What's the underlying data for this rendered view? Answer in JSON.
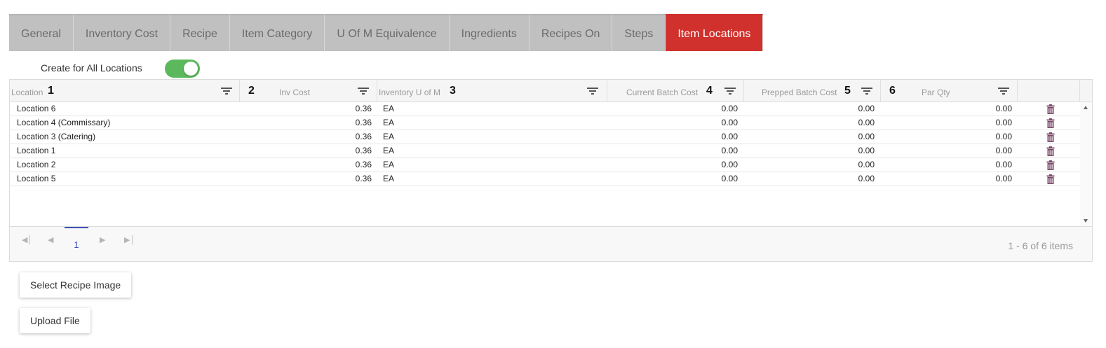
{
  "tabs": [
    {
      "label": "General"
    },
    {
      "label": "Inventory Cost"
    },
    {
      "label": "Recipe"
    },
    {
      "label": "Item Category"
    },
    {
      "label": "U Of M Equivalence"
    },
    {
      "label": "Ingredients"
    },
    {
      "label": "Recipes On"
    },
    {
      "label": "Steps"
    },
    {
      "label": "Item Locations",
      "active": true
    }
  ],
  "toggle": {
    "label": "Create for All Locations",
    "on": true
  },
  "grid": {
    "columns": [
      {
        "label": "Location",
        "num": "1"
      },
      {
        "label": "Inv Cost",
        "num": "2"
      },
      {
        "label": "Inventory U of M",
        "num": "3"
      },
      {
        "label": "Current Batch Cost",
        "num": "4"
      },
      {
        "label": "Prepped Batch Cost",
        "num": "5"
      },
      {
        "label": "Par Qty",
        "num": "6"
      }
    ],
    "rows": [
      {
        "location": "Location 6",
        "inv_cost": "0.36",
        "uom": "EA",
        "current": "0.00",
        "prepped": "0.00",
        "par": "0.00"
      },
      {
        "location": "Location 4 (Commissary)",
        "inv_cost": "0.36",
        "uom": "EA",
        "current": "0.00",
        "prepped": "0.00",
        "par": "0.00"
      },
      {
        "location": "Location 3 (Catering)",
        "inv_cost": "0.36",
        "uom": "EA",
        "current": "0.00",
        "prepped": "0.00",
        "par": "0.00"
      },
      {
        "location": "Location 1",
        "inv_cost": "0.36",
        "uom": "EA",
        "current": "0.00",
        "prepped": "0.00",
        "par": "0.00"
      },
      {
        "location": "Location 2",
        "inv_cost": "0.36",
        "uom": "EA",
        "current": "0.00",
        "prepped": "0.00",
        "par": "0.00"
      },
      {
        "location": "Location 5",
        "inv_cost": "0.36",
        "uom": "EA",
        "current": "0.00",
        "prepped": "0.00",
        "par": "0.00"
      }
    ]
  },
  "pager": {
    "page": "1",
    "info": "1 - 6 of 6 items"
  },
  "buttons": {
    "select_image": "Select Recipe Image",
    "upload": "Upload File"
  },
  "colors": {
    "active_tab": "#d0312d",
    "toggle_on": "#5cb85c",
    "trash": "#7a4a6a",
    "pager_accent": "#3f51b5"
  }
}
